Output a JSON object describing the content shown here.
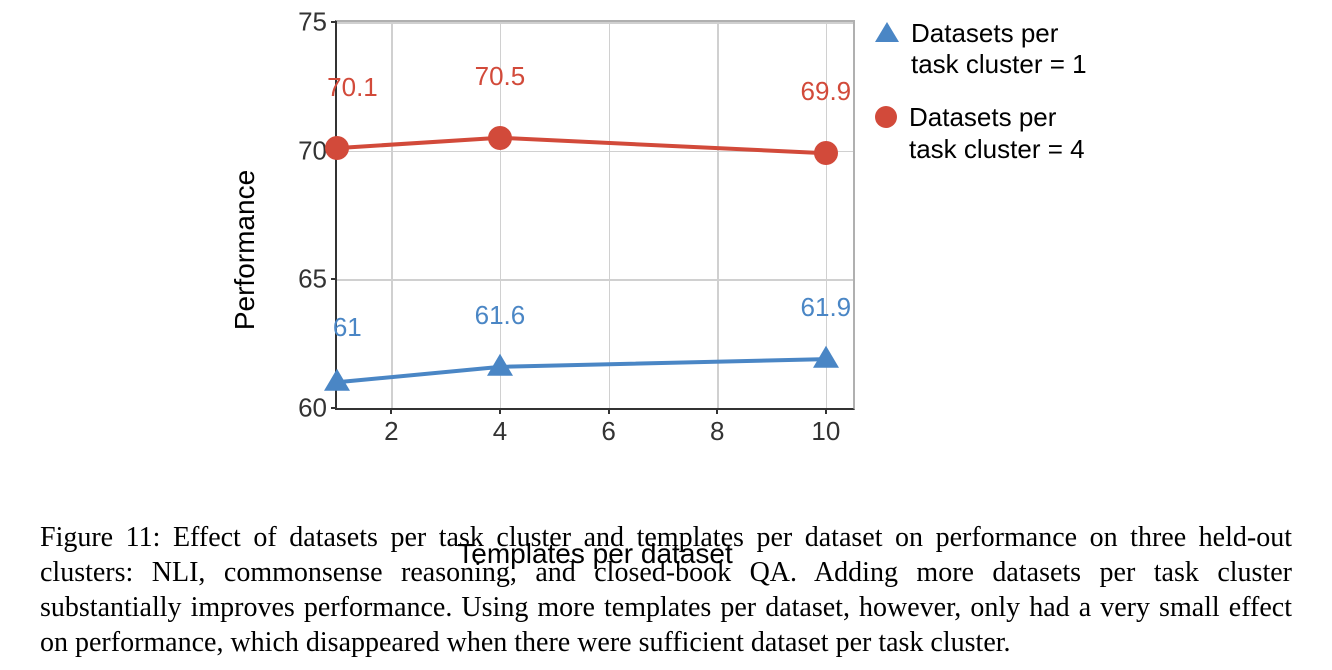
{
  "chart_data": {
    "type": "line",
    "xlabel": "Templates per dataset",
    "ylabel": "Performance",
    "x_ticks": [
      2,
      4,
      6,
      8,
      10
    ],
    "y_ticks": [
      60,
      65,
      70,
      75
    ],
    "xlim": [
      1,
      10.5
    ],
    "ylim": [
      60,
      75
    ],
    "grid": true,
    "series": [
      {
        "name": "Datasets per task cluster = 1",
        "marker": "triangle",
        "color": "#4a86c5",
        "x": [
          1,
          4,
          10
        ],
        "y": [
          61,
          61.6,
          61.9
        ],
        "labels": [
          "61",
          "61.6",
          "61.9"
        ]
      },
      {
        "name": "Datasets per task cluster = 4",
        "marker": "circle",
        "color": "#d24a3a",
        "x": [
          1,
          4,
          10
        ],
        "y": [
          70.1,
          70.5,
          69.9
        ],
        "labels": [
          "70.1",
          "70.5",
          "69.9"
        ]
      }
    ],
    "legend_position": "right"
  },
  "caption": "Figure 11: Effect of datasets per task cluster and templates per dataset on performance on three held-out clusters: NLI, commonsense reasoning, and closed-book QA. Adding more datasets per task cluster substantially improves performance. Using more templates per dataset, however, only had a very small effect on performance, which disappeared when there were sufficient dataset per task cluster."
}
